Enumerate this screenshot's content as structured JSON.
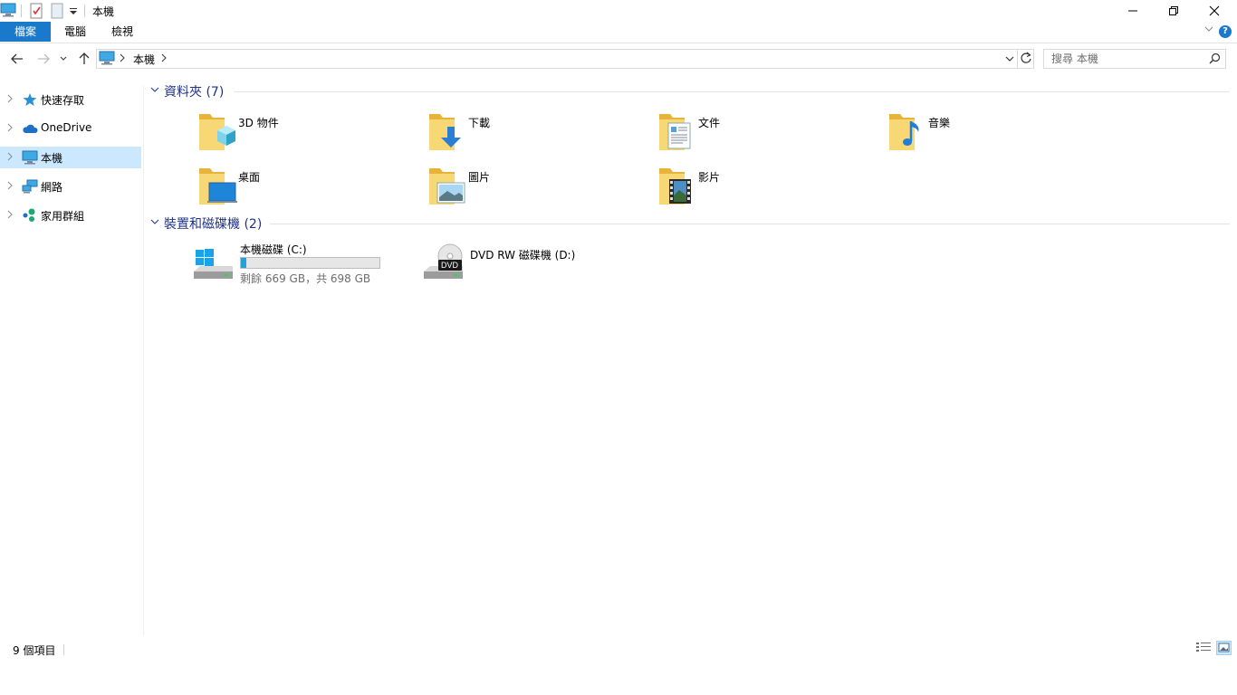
{
  "window": {
    "title": "本機",
    "minimize_icon": "minimize-icon",
    "maximize_icon": "restore-icon",
    "close_icon": "close-icon"
  },
  "ribbon": {
    "tabs": [
      {
        "label": "檔案",
        "active": true
      },
      {
        "label": "電腦"
      },
      {
        "label": "檢視"
      }
    ],
    "accent_color": "#1979ca"
  },
  "address": {
    "path": [
      "本機"
    ]
  },
  "search": {
    "placeholder": "搜尋 本機"
  },
  "nav_pane": {
    "items": [
      {
        "label": "快速存取",
        "icon": "star-icon"
      },
      {
        "label": "OneDrive",
        "icon": "cloud-icon"
      },
      {
        "label": "本機",
        "icon": "computer-icon",
        "selected": true
      },
      {
        "label": "網路",
        "icon": "network-icon"
      },
      {
        "label": "家用群組",
        "icon": "homegroup-icon"
      }
    ]
  },
  "content": {
    "folders_group": {
      "title": "資料夾 (7)",
      "items": [
        {
          "label": "3D 物件",
          "icon": "3d-objects-folder-icon"
        },
        {
          "label": "下載",
          "icon": "downloads-folder-icon"
        },
        {
          "label": "文件",
          "icon": "documents-folder-icon"
        },
        {
          "label": "音樂",
          "icon": "music-folder-icon"
        },
        {
          "label": "桌面",
          "icon": "desktop-folder-icon"
        },
        {
          "label": "圖片",
          "icon": "pictures-folder-icon"
        },
        {
          "label": "影片",
          "icon": "videos-folder-icon"
        }
      ]
    },
    "drives_group": {
      "title": "裝置和磁碟機 (2)",
      "items": [
        {
          "label": "本機磁碟 (C:)",
          "icon": "windows-drive-icon",
          "free_text": "剩餘 669 GB，共 698 GB",
          "used_fraction": 0.04
        },
        {
          "label": "DVD RW 磁碟機 (D:)",
          "icon": "dvd-drive-icon",
          "badge": "DVD"
        }
      ]
    }
  },
  "status": {
    "item_count": "9 個項目"
  }
}
